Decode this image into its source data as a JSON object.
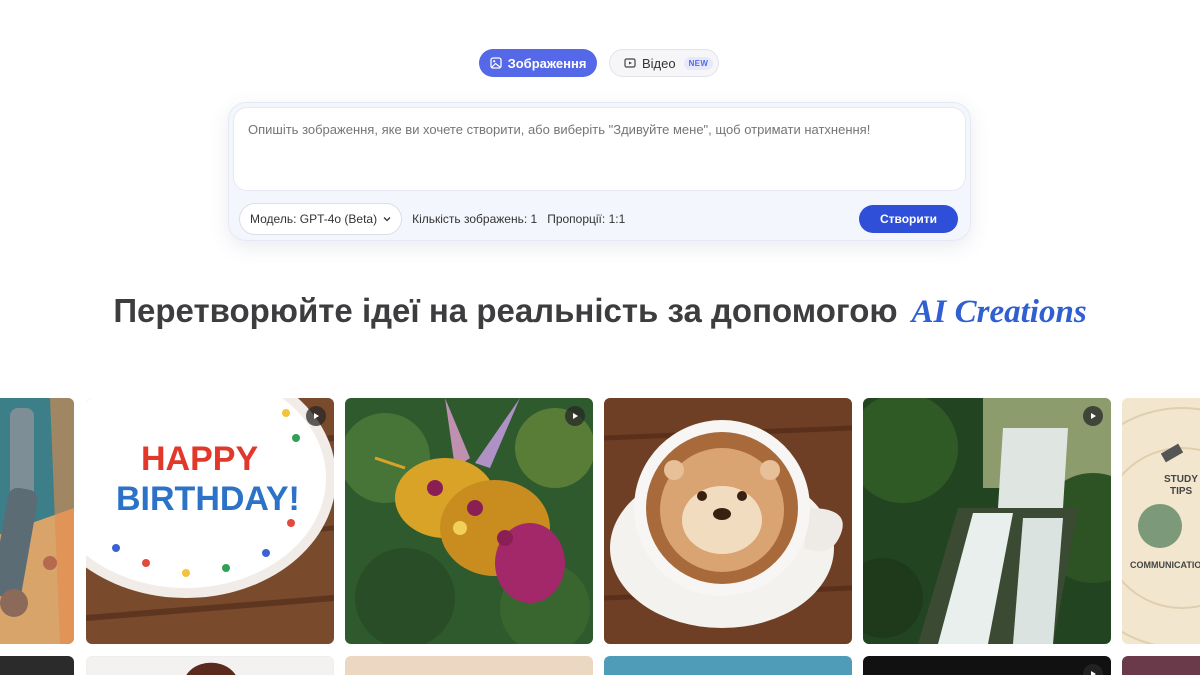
{
  "tabs": {
    "image_label": "Зображення",
    "video_label": "Відео",
    "video_badge": "NEW"
  },
  "prompt": {
    "placeholder": "Опишіть зображення, яке ви хочете створити, або виберіть \"Здивуйте мене\", щоб отримати натхнення!"
  },
  "controls": {
    "model_label": "Модель: GPT-4o (Beta)",
    "count_label": "Кількість зображень: 1",
    "ratio_label": "Пропорції: 1:1",
    "create_label": "Створити"
  },
  "heading": {
    "main": "Перетворюйте ідеї на реальність за допомогою",
    "accent": "AI Creations"
  },
  "gallery": {
    "cake_text_1": "HAPPY",
    "cake_text_2": "BIRTHDAY!",
    "poster_text_1": "STUDY",
    "poster_text_2": "TIPS",
    "poster_text_3": "COMMUNICATION",
    "tiles": [
      {
        "subject": "robot-arm-poster",
        "icon": "none"
      },
      {
        "subject": "birthday-cake",
        "icon": "play-icon"
      },
      {
        "subject": "flower-bee",
        "icon": "play-icon"
      },
      {
        "subject": "otter-latte",
        "icon": "none"
      },
      {
        "subject": "forest-waterfall",
        "icon": "play-icon"
      },
      {
        "subject": "study-tips-poster",
        "icon": "none"
      }
    ]
  },
  "colors": {
    "accent": "#5468e8",
    "create_button": "#2f4fd8",
    "heading_accent": "#2f5fd0"
  }
}
